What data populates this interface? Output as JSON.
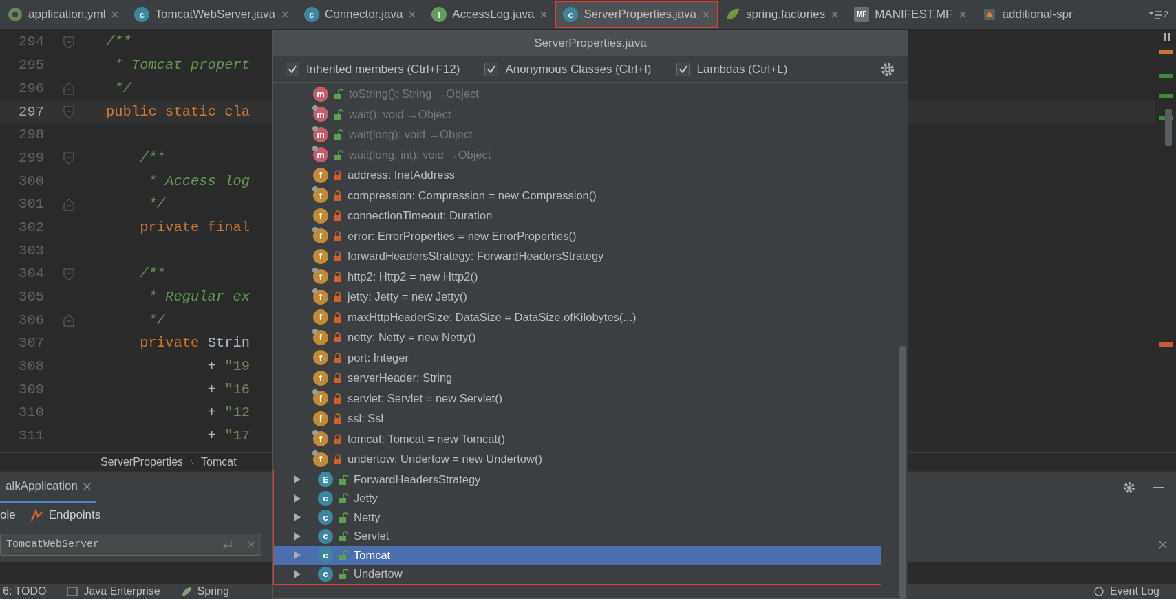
{
  "tabs": [
    {
      "label": "application.yml",
      "kind": "yaml",
      "selected": false,
      "highlighted": false
    },
    {
      "label": "TomcatWebServer.java",
      "kind": "class",
      "icon_letter": "c",
      "selected": false,
      "highlighted": false
    },
    {
      "label": "Connector.java",
      "kind": "class",
      "icon_letter": "c",
      "selected": false,
      "highlighted": false
    },
    {
      "label": "AccessLog.java",
      "kind": "interface",
      "icon_letter": "I",
      "selected": false,
      "highlighted": false
    },
    {
      "label": "ServerProperties.java",
      "kind": "class",
      "icon_letter": "c",
      "selected": true,
      "highlighted": true
    },
    {
      "label": "spring.factories",
      "kind": "spring",
      "selected": false,
      "highlighted": false
    },
    {
      "label": "MANIFEST.MF",
      "kind": "manifest",
      "icon_letter": "MF",
      "selected": false,
      "highlighted": false
    },
    {
      "label": "additional-spr",
      "kind": "json",
      "selected": false,
      "highlighted": false
    }
  ],
  "tab_overflow": "2",
  "editor": {
    "lines": [
      {
        "number": "294",
        "current": false,
        "tokens": [
          {
            "kind": "comment",
            "text": "/**"
          }
        ]
      },
      {
        "number": "295",
        "current": false,
        "tokens": [
          {
            "kind": "comment",
            "text": " * Tomcat propert"
          }
        ]
      },
      {
        "number": "296",
        "current": false,
        "tokens": [
          {
            "kind": "comment",
            "text": " */"
          }
        ]
      },
      {
        "number": "297",
        "current": true,
        "tokens": [
          {
            "kind": "keyword",
            "text": "public static cla"
          }
        ]
      },
      {
        "number": "298",
        "current": false
      },
      {
        "number": "299",
        "current": false,
        "tokens": [
          {
            "kind": "comment",
            "text": "    /**"
          }
        ]
      },
      {
        "number": "300",
        "current": false,
        "tokens": [
          {
            "kind": "comment",
            "text": "     * Access log"
          }
        ]
      },
      {
        "number": "301",
        "current": false,
        "tokens": [
          {
            "kind": "comment",
            "text": "     */"
          }
        ]
      },
      {
        "number": "302",
        "current": false,
        "tokens": [
          {
            "kind": "keyword",
            "text": "    private final"
          }
        ]
      },
      {
        "number": "303",
        "current": false
      },
      {
        "number": "304",
        "current": false,
        "tokens": [
          {
            "kind": "comment",
            "text": "    /**"
          }
        ]
      },
      {
        "number": "305",
        "current": false,
        "tokens": [
          {
            "kind": "comment",
            "text": "     * Regular ex"
          }
        ]
      },
      {
        "number": "306",
        "current": false,
        "tokens": [
          {
            "kind": "comment",
            "text": "     */"
          }
        ]
      },
      {
        "number": "307",
        "current": false,
        "tokens": [
          {
            "kind": "keyword",
            "text": "    private "
          },
          {
            "kind": "plain",
            "text": "Strin"
          }
        ]
      },
      {
        "number": "308",
        "current": false,
        "tokens": [
          {
            "kind": "plain",
            "text": "            + "
          },
          {
            "kind": "string",
            "text": "\"19"
          }
        ]
      },
      {
        "number": "309",
        "current": false,
        "tokens": [
          {
            "kind": "plain",
            "text": "            + "
          },
          {
            "kind": "string",
            "text": "\"16"
          }
        ]
      },
      {
        "number": "310",
        "current": false,
        "tokens": [
          {
            "kind": "plain",
            "text": "            + "
          },
          {
            "kind": "string",
            "text": "\"12"
          }
        ]
      },
      {
        "number": "311",
        "current": false,
        "tokens": [
          {
            "kind": "plain",
            "text": "            + "
          },
          {
            "kind": "string",
            "text": "\"17"
          }
        ]
      }
    ]
  },
  "breadcrumb": [
    "ServerProperties",
    "Tomcat"
  ],
  "run_panel": {
    "tab": "alkApplication",
    "subtabs": [
      "ole",
      "Endpoints"
    ],
    "search": {
      "value": "TomcatWebServer"
    }
  },
  "status_bar": {
    "items": [
      "6: TODO",
      "Java Enterprise",
      "Spring"
    ],
    "event_log": "Event Log"
  },
  "popup": {
    "title": "ServerProperties.java",
    "filters": [
      {
        "label": "Inherited members (Ctrl+F12)",
        "checked": true
      },
      {
        "label": "Anonymous Classes (Ctrl+I)",
        "checked": true
      },
      {
        "label": "Lambdas (Ctrl+L)",
        "checked": true
      }
    ],
    "members": [
      {
        "kind": "method",
        "icon_letter": "m",
        "text": "toString(): String →Object",
        "inherited": true,
        "locked": false,
        "final": false
      },
      {
        "kind": "method",
        "icon_letter": "m",
        "text": "wait(): void →Object",
        "inherited": true,
        "locked": false,
        "final": true
      },
      {
        "kind": "method",
        "icon_letter": "m",
        "text": "wait(long): void →Object",
        "inherited": true,
        "locked": false,
        "final": true
      },
      {
        "kind": "method",
        "icon_letter": "m",
        "text": "wait(long, int): void →Object",
        "inherited": true,
        "locked": false,
        "final": true
      },
      {
        "kind": "field",
        "icon_letter": "f",
        "text": "address: InetAddress",
        "inherited": false,
        "locked": true,
        "final": false
      },
      {
        "kind": "field",
        "icon_letter": "f",
        "text": "compression: Compression = new Compression()",
        "inherited": false,
        "locked": true,
        "final": true
      },
      {
        "kind": "field",
        "icon_letter": "f",
        "text": "connectionTimeout: Duration",
        "inherited": false,
        "locked": true,
        "final": false
      },
      {
        "kind": "field",
        "icon_letter": "f",
        "text": "error: ErrorProperties = new ErrorProperties()",
        "inherited": false,
        "locked": true,
        "final": true
      },
      {
        "kind": "field",
        "icon_letter": "f",
        "text": "forwardHeadersStrategy: ForwardHeadersStrategy",
        "inherited": false,
        "locked": true,
        "final": false
      },
      {
        "kind": "field",
        "icon_letter": "f",
        "text": "http2: Http2 = new Http2()",
        "inherited": false,
        "locked": true,
        "final": true
      },
      {
        "kind": "field",
        "icon_letter": "f",
        "text": "jetty: Jetty = new Jetty()",
        "inherited": false,
        "locked": true,
        "final": true
      },
      {
        "kind": "field",
        "icon_letter": "f",
        "text": "maxHttpHeaderSize: DataSize = DataSize.ofKilobytes(...)",
        "inherited": false,
        "locked": true,
        "final": false
      },
      {
        "kind": "field",
        "icon_letter": "f",
        "text": "netty: Netty = new Netty()",
        "inherited": false,
        "locked": true,
        "final": true
      },
      {
        "kind": "field",
        "icon_letter": "f",
        "text": "port: Integer",
        "inherited": false,
        "locked": true,
        "final": false
      },
      {
        "kind": "field",
        "icon_letter": "f",
        "text": "serverHeader: String",
        "inherited": false,
        "locked": true,
        "final": false
      },
      {
        "kind": "field",
        "icon_letter": "f",
        "text": "servlet: Servlet = new Servlet()",
        "inherited": false,
        "locked": true,
        "final": true
      },
      {
        "kind": "field",
        "icon_letter": "f",
        "text": "ssl: Ssl",
        "inherited": false,
        "locked": true,
        "final": false
      },
      {
        "kind": "field",
        "icon_letter": "f",
        "text": "tomcat: Tomcat = new Tomcat()",
        "inherited": false,
        "locked": true,
        "final": true
      },
      {
        "kind": "field",
        "icon_letter": "f",
        "text": "undertow: Undertow = new Undertow()",
        "inherited": false,
        "locked": true,
        "final": true
      }
    ],
    "nested_classes": {
      "highlighted": true,
      "rows": [
        {
          "kind": "enum",
          "icon_letter": "E",
          "text": "ForwardHeadersStrategy",
          "expanded": false,
          "selected": false
        },
        {
          "kind": "class",
          "icon_letter": "c",
          "text": "Jetty",
          "expanded": false,
          "selected": false
        },
        {
          "kind": "class",
          "icon_letter": "c",
          "text": "Netty",
          "expanded": false,
          "selected": false
        },
        {
          "kind": "class",
          "icon_letter": "c",
          "text": "Servlet",
          "expanded": false,
          "selected": false
        },
        {
          "kind": "class",
          "icon_letter": "c",
          "text": "Tomcat",
          "expanded": false,
          "selected": true
        },
        {
          "kind": "class",
          "icon_letter": "c",
          "text": "Undertow",
          "expanded": false,
          "selected": false
        }
      ]
    }
  }
}
